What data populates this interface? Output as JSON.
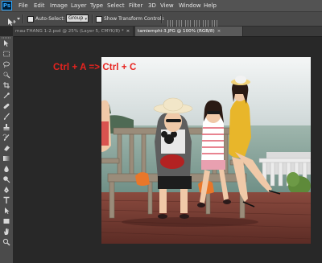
{
  "app": {
    "logo": "Ps",
    "menu": [
      "File",
      "Edit",
      "Image",
      "Layer",
      "Type",
      "Select",
      "Filter",
      "3D",
      "View",
      "Window",
      "Help"
    ]
  },
  "options_bar": {
    "tool_icon": "move-tool-icon",
    "auto_select_label": "Auto-Select:",
    "auto_select_value": "Group",
    "show_transform_label": "Show Transform Controls"
  },
  "tabs": [
    {
      "label": "mau-THANG 1-2.psd @ 25% (Layer 5, CMYK/8) *",
      "close": "×",
      "active": false
    },
    {
      "label": "tamiemphi-3.JPG @ 100% (RGB/8)",
      "close": "×",
      "active": true
    }
  ],
  "toolbar": {
    "tools": [
      "move-tool-icon",
      "marquee-tool-icon",
      "lasso-tool-icon",
      "quick-select-tool-icon",
      "crop-tool-icon",
      "eyedropper-tool-icon",
      "healing-brush-tool-icon",
      "brush-tool-icon",
      "clone-stamp-tool-icon",
      "history-brush-tool-icon",
      "eraser-tool-icon",
      "gradient-tool-icon",
      "blur-tool-icon",
      "dodge-tool-icon",
      "pen-tool-icon",
      "type-tool-icon",
      "path-select-tool-icon",
      "shape-tool-icon",
      "hand-tool-icon",
      "zoom-tool-icon"
    ]
  },
  "annotation": "Ctrl + A => Ctrl + C",
  "colors": {
    "annotation": "#e8231f",
    "menubar": "#535353",
    "optionsbar": "#4a4a4a",
    "workspace": "#282828",
    "active_tab": "#5a5a5a"
  }
}
